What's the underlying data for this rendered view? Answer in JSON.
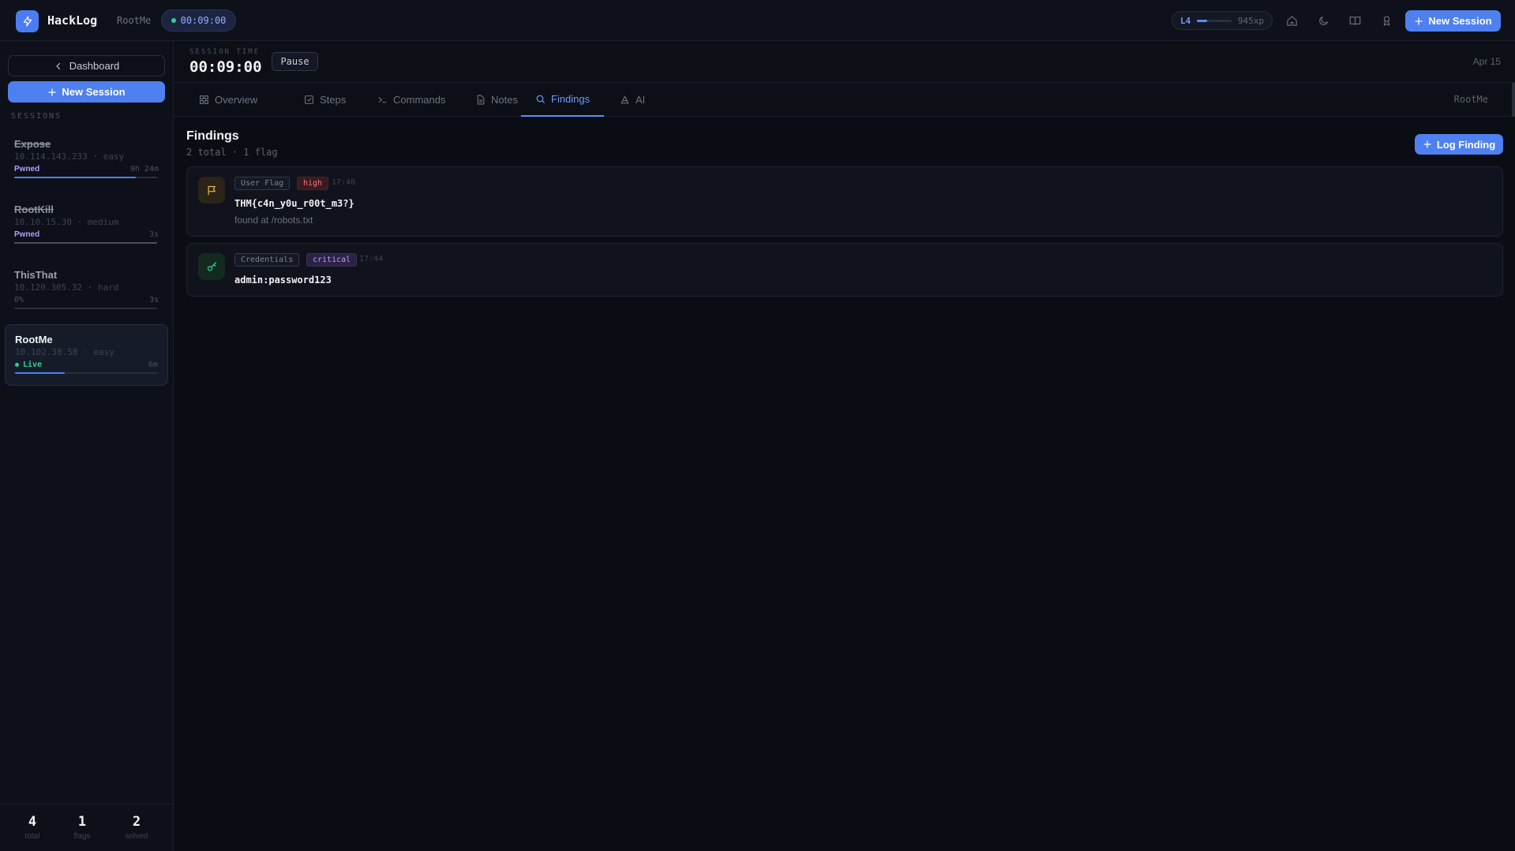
{
  "topbar": {
    "app_name": "HackLog",
    "current_session": "RootMe",
    "timer": "00:09:00",
    "level": "L4",
    "xp_text": "945xp",
    "xp_progress": 0.3,
    "new_session_label": "New Session"
  },
  "sidebar": {
    "dashboard_label": "Dashboard",
    "new_session_label": "New Session",
    "sessions_heading": "SESSIONS",
    "sessions": [
      {
        "name": "Expose",
        "meta": "10.114.143.233 · easy",
        "status": "Pwned",
        "time": "9h 24m",
        "progress": 0.85,
        "struck": true
      },
      {
        "name": "RootKill",
        "meta": "10.10.15.30 · medium",
        "status": "Pwned",
        "time": "3s",
        "progress": 1.0,
        "struck": true
      },
      {
        "name": "ThisThat",
        "meta": "10.120.305.32 · hard",
        "status": "0%",
        "time": "3s",
        "progress": 0.0,
        "struck": false
      },
      {
        "name": "RootMe",
        "meta": "10.102.38.58 · easy",
        "status": "Live",
        "time": "6m",
        "progress": 0.35,
        "struck": false
      }
    ],
    "stats": [
      {
        "value": "4",
        "label": "total"
      },
      {
        "value": "1",
        "label": "flags"
      },
      {
        "value": "2",
        "label": "solved"
      }
    ]
  },
  "session_header": {
    "label": "SESSION TIME",
    "time": "00:09:00",
    "pause_label": "Pause",
    "date": "Apr 15"
  },
  "tabs": {
    "items": [
      {
        "label": "Overview"
      },
      {
        "label": "Steps"
      },
      {
        "label": "Commands"
      },
      {
        "label": "Notes"
      },
      {
        "label": "Findings"
      },
      {
        "label": "AI"
      }
    ],
    "active": "Findings",
    "session_name": "RootMe"
  },
  "findings": {
    "title": "Findings",
    "summary": "2 total · 1 flag",
    "log_label": "Log Finding",
    "items": [
      {
        "type": "User Flag",
        "severity": "high",
        "time": "17:40",
        "value": "THM{c4n_y0u_r00t_m3?}",
        "note": "found at /robots.txt"
      },
      {
        "type": "Credentials",
        "severity": "critical",
        "time": "17:44",
        "value": "admin:password123",
        "note": ""
      }
    ]
  },
  "colors": {
    "accent": "#4f80f0",
    "pwned": "#b59cff",
    "live": "#2fd18b",
    "high": "#f07a86",
    "critical": "#b79cff"
  }
}
